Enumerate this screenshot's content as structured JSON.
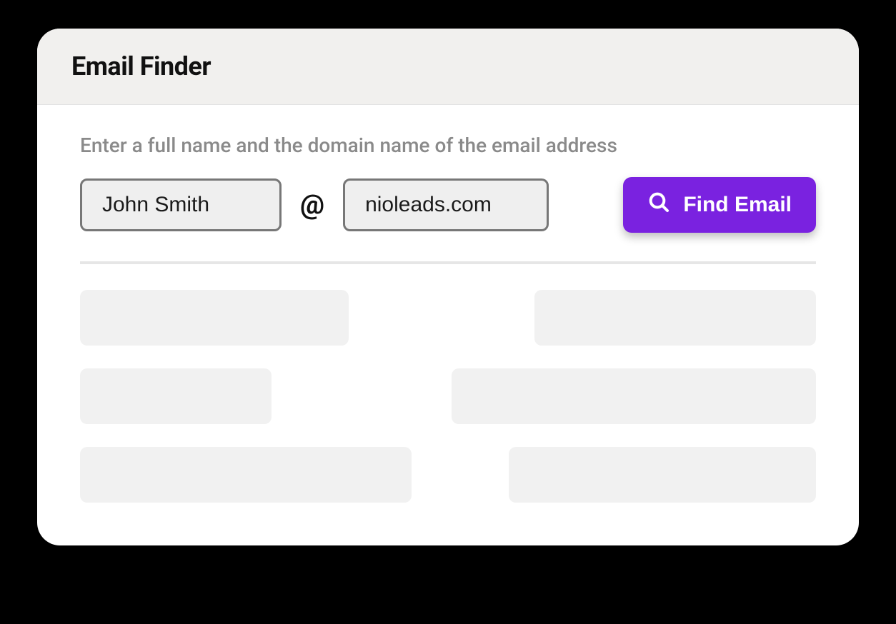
{
  "header": {
    "title": "Email Finder"
  },
  "form": {
    "instruction": "Enter a full name and the domain name of the email address",
    "name_placeholder": "John Smith",
    "name_value": "John Smith",
    "at_symbol": "@",
    "domain_placeholder": "nioleads.com",
    "domain_value": "nioleads.com",
    "button_label": "Find Email"
  },
  "colors": {
    "accent": "#7a22e0"
  }
}
